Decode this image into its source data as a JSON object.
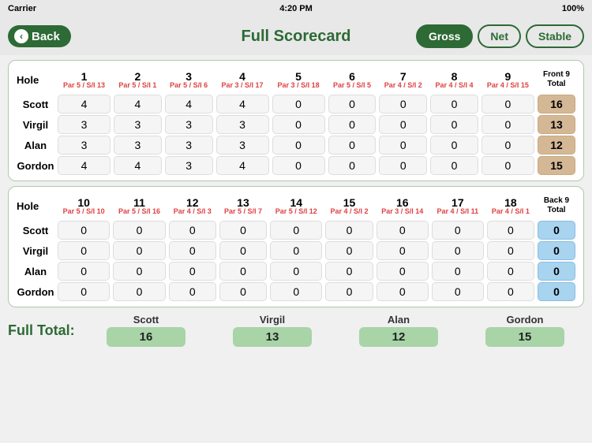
{
  "statusBar": {
    "carrier": "Carrier",
    "time": "4:20 PM",
    "signal": "100%"
  },
  "header": {
    "backLabel": "Back",
    "title": "Full Scorecard",
    "buttons": [
      "Gross",
      "Net",
      "Stable"
    ],
    "activeButton": "Gross"
  },
  "front9": {
    "sectionLabel": "Front 9",
    "holes": [
      {
        "num": "1",
        "par": "5",
        "si": "13"
      },
      {
        "num": "2",
        "par": "5",
        "si": "1"
      },
      {
        "num": "3",
        "par": "5",
        "si": "6"
      },
      {
        "num": "4",
        "par": "3",
        "si": "17"
      },
      {
        "num": "5",
        "par": "3",
        "si": "18"
      },
      {
        "num": "6",
        "par": "5",
        "si": "5"
      },
      {
        "num": "7",
        "par": "4",
        "si": "2"
      },
      {
        "num": "8",
        "par": "4",
        "si": "4"
      },
      {
        "num": "9",
        "par": "4",
        "si": "15"
      }
    ],
    "totalLabel": "Front 9\nTotal",
    "players": [
      {
        "name": "Scott",
        "scores": [
          4,
          4,
          4,
          4,
          0,
          0,
          0,
          0,
          0
        ],
        "total": 16
      },
      {
        "name": "Virgil",
        "scores": [
          3,
          3,
          3,
          3,
          0,
          0,
          0,
          0,
          0
        ],
        "total": 13
      },
      {
        "name": "Alan",
        "scores": [
          3,
          3,
          3,
          3,
          0,
          0,
          0,
          0,
          0
        ],
        "total": 12
      },
      {
        "name": "Gordon",
        "scores": [
          4,
          4,
          3,
          4,
          0,
          0,
          0,
          0,
          0
        ],
        "total": 15
      }
    ]
  },
  "back9": {
    "sectionLabel": "Back 9",
    "holes": [
      {
        "num": "10",
        "par": "5",
        "si": "10"
      },
      {
        "num": "11",
        "par": "5",
        "si": "16"
      },
      {
        "num": "12",
        "par": "4",
        "si": "3"
      },
      {
        "num": "13",
        "par": "5",
        "si": "7"
      },
      {
        "num": "14",
        "par": "5",
        "si": "12"
      },
      {
        "num": "15",
        "par": "4",
        "si": "2"
      },
      {
        "num": "16",
        "par": "3",
        "si": "14"
      },
      {
        "num": "17",
        "par": "4",
        "si": "11"
      },
      {
        "num": "18",
        "par": "4",
        "si": "1"
      }
    ],
    "totalLabel": "Back 9\nTotal",
    "players": [
      {
        "name": "Scott",
        "scores": [
          0,
          0,
          0,
          0,
          0,
          0,
          0,
          0,
          0
        ],
        "total": 0
      },
      {
        "name": "Virgil",
        "scores": [
          0,
          0,
          0,
          0,
          0,
          0,
          0,
          0,
          0
        ],
        "total": 0
      },
      {
        "name": "Alan",
        "scores": [
          0,
          0,
          0,
          0,
          0,
          0,
          0,
          0,
          0
        ],
        "total": 0
      },
      {
        "name": "Gordon",
        "scores": [
          0,
          0,
          0,
          0,
          0,
          0,
          0,
          0,
          0
        ],
        "total": 0
      }
    ]
  },
  "fullTotal": {
    "label": "Full Total:",
    "players": [
      {
        "name": "Scott",
        "total": 16
      },
      {
        "name": "Virgil",
        "total": 13
      },
      {
        "name": "Alan",
        "total": 12
      },
      {
        "name": "Gordon",
        "total": 15
      }
    ]
  }
}
